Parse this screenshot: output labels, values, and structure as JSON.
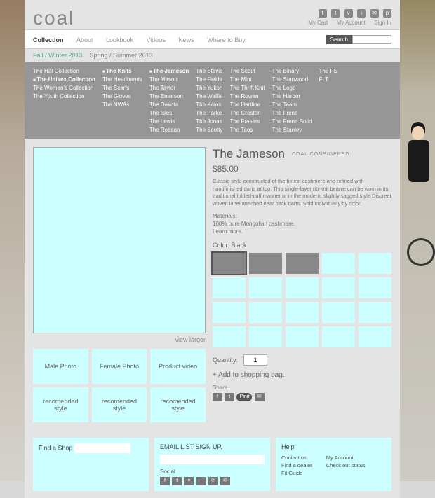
{
  "brand": "coal",
  "header_links": {
    "cart": "My Cart",
    "account": "My Account",
    "signin": "Sign In"
  },
  "nav": {
    "collection": "Collection",
    "about": "About",
    "lookbook": "Lookbook",
    "videos": "Videos",
    "news": "News",
    "where": "Where to Buy",
    "search": "Search"
  },
  "season": {
    "current": "Fall / Winter 2013",
    "next": "Spring / Summer 2013"
  },
  "mega": {
    "c0": [
      "The Hat Collection",
      "The Unisex Collection",
      "The Women's Collection",
      "The Youth Collection"
    ],
    "c1": [
      "The Knits",
      "The Headbands",
      "The Scarfs",
      "The Gloves",
      "The NWAs"
    ],
    "c2": [
      "The Jameson",
      "The Mason",
      "The Taylor",
      "The Emerson",
      "The Dakota",
      "The Isles",
      "The Lewis",
      "The Robson"
    ],
    "c3": [
      "The Stevie",
      "The Fields",
      "The Yukon",
      "The Waffle",
      "The Kalos",
      "The Parke",
      "The Jonas",
      "The Scotty"
    ],
    "c4": [
      "The Scout",
      "The Mint",
      "The Thrift Knit",
      "The Rowan",
      "The Hartline",
      "The Creston",
      "The Frasers",
      "The Taos"
    ],
    "c5": [
      "The Binary",
      "The Stanwood",
      "The Logo",
      "The Harbor",
      "The Team",
      "The Frena",
      "The Frena Solid",
      "The Stanley"
    ],
    "c6": [
      "The FS",
      "FLT"
    ]
  },
  "product": {
    "name": "The Jameson",
    "considered": "COAL CONSIDERED",
    "price": "$85.00",
    "desc": "Classic style constructed of the fi nest cashmere and refined with handfinished darts at top. This single-layer rib-knit beanie can be worn in its traditional folded-cuff manner or in the modern, slightly sagged style.Discreet woven label attached near back darts. Sold individually by color.",
    "materials_lbl": "Materials:",
    "materials": "100% pure Mongolian cashmere.",
    "learn": "Learn more.",
    "color_lbl": "Color: Black",
    "view_larger": "view larger",
    "qty_lbl": "Quantity:",
    "qty": "1",
    "add": "+ Add to shopping bag.",
    "share": "Share"
  },
  "thumbs": {
    "male": "Male Photo",
    "female": "Female Photo",
    "video": "Product video",
    "rec": "recomended style"
  },
  "footer": {
    "findshop": "Find a Shop",
    "email": "EMAIL LIST SIGN UP.",
    "social": "Social",
    "help": "Help",
    "contact": "Contact us.",
    "dealer": "Find a dealer",
    "fit": "Fit Guide",
    "account": "My Account",
    "status": "Check out status"
  }
}
